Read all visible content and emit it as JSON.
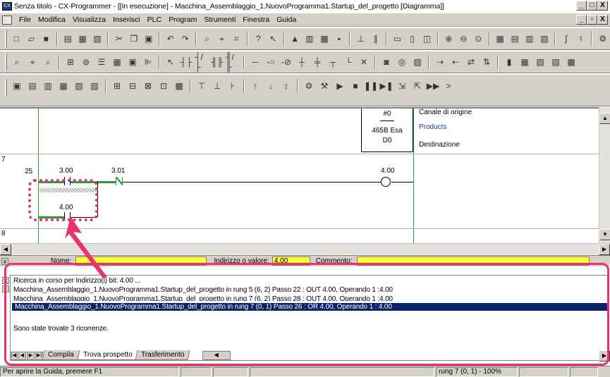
{
  "window": {
    "title": "Senza titolo - CX-Programmer - [[In esecuzione] - Macchina_Assemblaggio_1.NuovoProgramma1.Startup_del_progetto [Diagramma]]",
    "app_icon_text": "CX",
    "buttons": {
      "minimize": "_",
      "maximize": "□",
      "close": "X"
    },
    "doc_buttons": {
      "minimize": "_",
      "restore": "▫",
      "close": "X"
    }
  },
  "menu": {
    "items": [
      "File",
      "Modifica",
      "Visualizza",
      "Inserisci",
      "PLC",
      "Program",
      "Strumenti",
      "Finestra",
      "Guida"
    ]
  },
  "ladder": {
    "rung_7_number": "7",
    "rung_7_step": "25",
    "rung_8_number": "8",
    "contact_1": "3.00",
    "contact_2": "3.01",
    "contact_branch": "4.00",
    "coil": "4.00",
    "instruction": {
      "top": "#0",
      "middle": "465B Esa",
      "bottom": "D0"
    },
    "instruction_info": {
      "line1": "Canale di origine",
      "line2": "Products",
      "line3": "Destinazione"
    },
    "colors": {
      "rail": "#2a9a3a",
      "products": "#1a3aa0"
    }
  },
  "find_bar": {
    "name_label": "Nome:",
    "address_label": "Indirizzo o valore:",
    "address_value": "4.00",
    "comment_label": "Commento:"
  },
  "output": {
    "lines": [
      "Ricerca in corso per Indirizzo(i) bit: 4.00 ...",
      "Macchina_Assemblaggio_1.NuovoProgramma1.Startup_del_progetto in rung 5 (6, 2) Passo 22 : OUT 4.00, Operando 1 :4.00",
      "Macchina_Assemblaggio_1.NuovoProgramma1.Startup_del_progetto in rung 7 (6, 2) Passo 28 : OUT 4.00, Operando 1 :4.00",
      "Macchina_Assemblaggio_1.NuovoProgramma1.Startup_del_progetto in rung 7 (0, 1) Passo 26 : OR 4.00, Operando 1 : 4.00"
    ],
    "result": "Sono state trovate 3 ricorrenze.",
    "tabs": [
      "Compila",
      "Trova prospetto",
      "Trasferimento"
    ],
    "active_tab": "Trova prospetto"
  },
  "status": {
    "help": "Per aprire la Guida, premere F1",
    "position": "rung 7 (0, 1) - 100%"
  },
  "highlight_color": "#e8336c"
}
